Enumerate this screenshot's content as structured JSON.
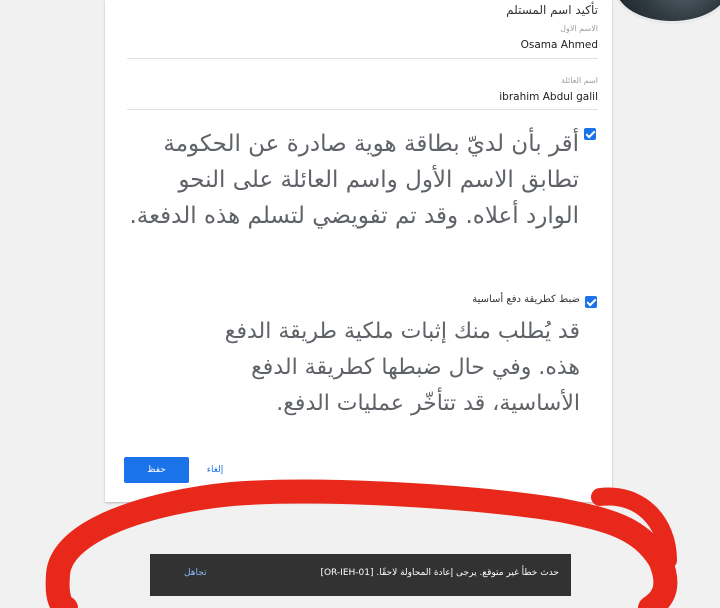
{
  "form": {
    "section_title": "تأكيد اسم المستلم",
    "first_name_label": "الاسم الاول",
    "first_name_value": "Osama Ahmed",
    "last_name_label": "اسم العائلة",
    "last_name_value": "ibrahim Abdul galil"
  },
  "consent": {
    "checked": true,
    "text": "أقر بأن لديّ بطاقة هوية صادرة عن الحكومة تطابق الاسم الأول واسم العائلة على النحو الوارد أعلاه. وقد تم تفويضي لتسلم هذه الدفعة."
  },
  "primary_payment": {
    "checked": true,
    "label": "ضبط كطريقة دفع أساسية",
    "description": "قد يُطلب منك إثبات ملكية طريقة الدفع هذه. وفي حال ضبطها كطريقة الدفع الأساسية، قد تتأخّر عمليات الدفع."
  },
  "actions": {
    "save_label": "حفظ",
    "cancel_label": "إلغاء"
  },
  "snackbar": {
    "message": "حدث خطأ غير متوقع. يرجى إعادة المحاولة لاحقًا. [OR-IEH-01]",
    "action_label": "تجاهل"
  },
  "colors": {
    "accent": "#1a73e8",
    "snackbar_bg": "#323232",
    "annotation": "#e8281b"
  }
}
